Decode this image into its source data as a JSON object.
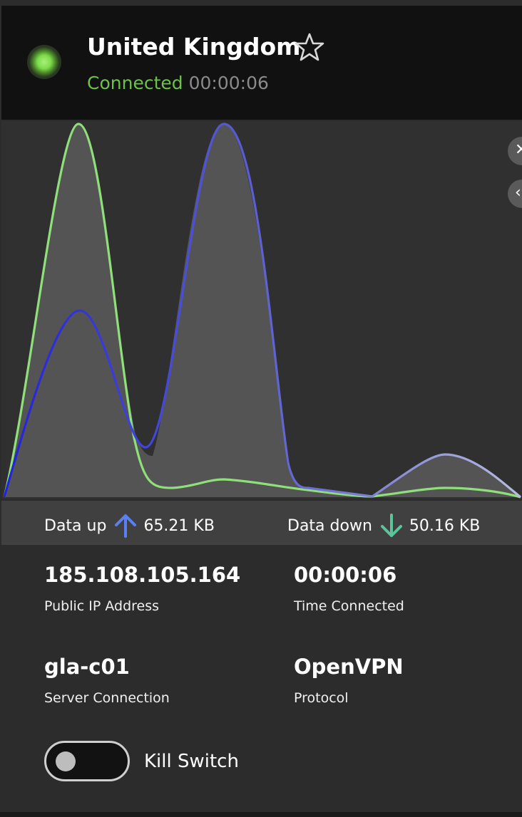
{
  "header": {
    "country": "United Kingdom",
    "status": "Connected",
    "timer": "00:00:06"
  },
  "rates": {
    "up_label": "Data up",
    "up_value": "65.21 KB",
    "down_label": "Data down",
    "down_value": "50.16 KB"
  },
  "info": {
    "ip_value": "185.108.105.164",
    "ip_label": "Public IP Address",
    "time_value": "00:00:06",
    "time_label": "Time Connected",
    "server_value": "gla-c01",
    "server_label": "Server Connection",
    "protocol_value": "OpenVPN",
    "protocol_label": "Protocol"
  },
  "kill_switch": {
    "label": "Kill Switch",
    "enabled": false
  },
  "colors": {
    "connected": "#6cc24a",
    "upload_series": "#4a4ed8",
    "download_series": "#8fe07a",
    "led": "#7ddc4a"
  },
  "icons": {
    "favorite": "star-outline-icon",
    "upload": "arrow-up-icon",
    "download": "arrow-down-icon"
  }
}
